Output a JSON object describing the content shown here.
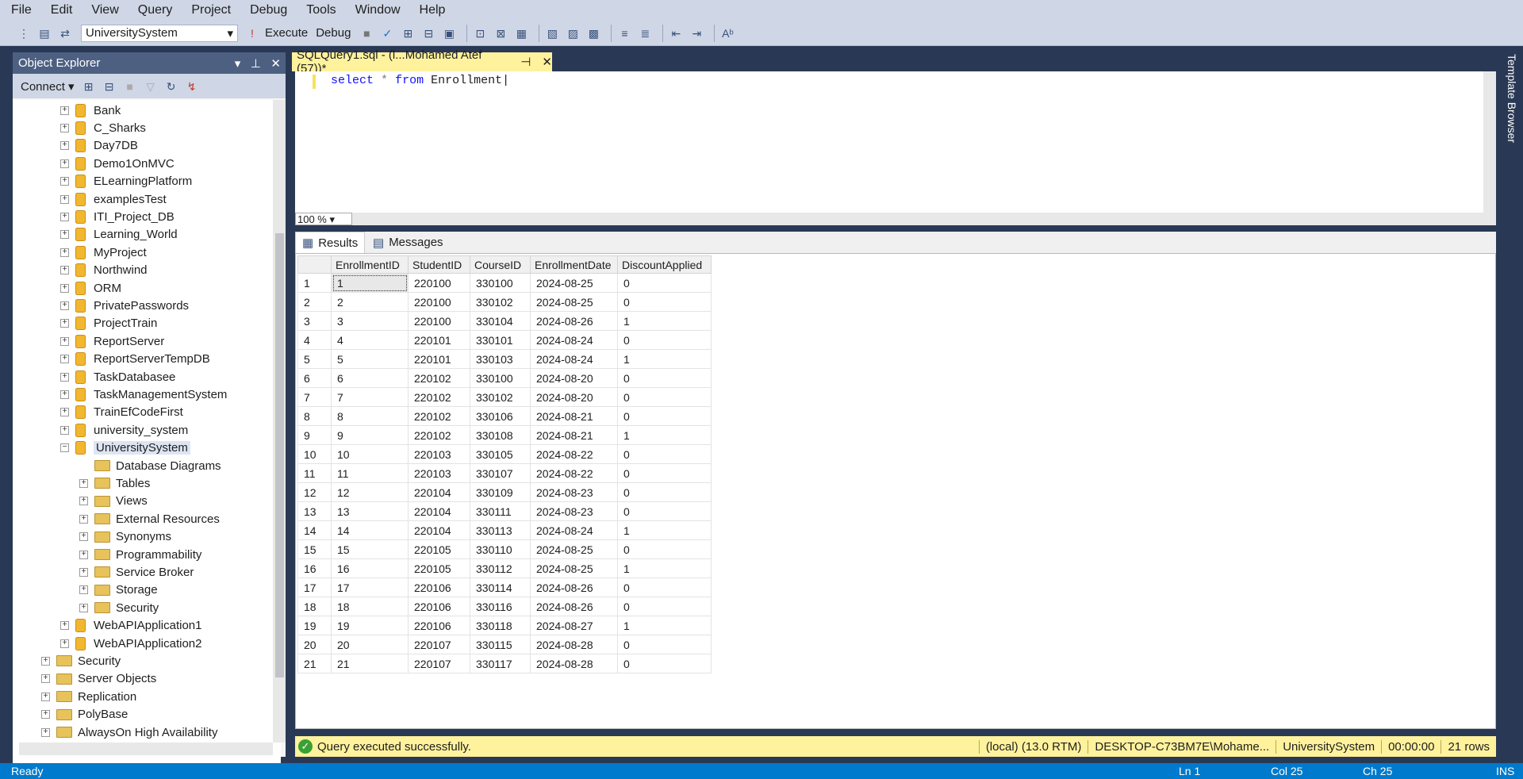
{
  "menu": [
    "File",
    "Edit",
    "View",
    "Query",
    "Project",
    "Debug",
    "Tools",
    "Window",
    "Help"
  ],
  "toolbar": {
    "database": "UniversitySystem",
    "execute": "Execute",
    "debug": "Debug"
  },
  "object_explorer": {
    "title": "Object Explorer",
    "connect": "Connect",
    "databases": [
      "Bank",
      "C_Sharks",
      "Day7DB",
      "Demo1OnMVC",
      "ELearningPlatform",
      "examplesTest",
      "ITI_Project_DB",
      "Learning_World",
      "MyProject",
      "Northwind",
      "ORM",
      "PrivatePasswords",
      "ProjectTrain",
      "ReportServer",
      "ReportServerTempDB",
      "TaskDatabasee",
      "TaskManagementSystem",
      "TrainEfCodeFirst",
      "university_system",
      "UniversitySystem"
    ],
    "university_children": [
      "Database Diagrams",
      "Tables",
      "Views",
      "External Resources",
      "Synonyms",
      "Programmability",
      "Service Broker",
      "Storage",
      "Security"
    ],
    "more_databases": [
      "WebAPIApplication1",
      "WebAPIApplication2"
    ],
    "server_nodes": [
      "Security",
      "Server Objects",
      "Replication",
      "PolyBase",
      "AlwaysOn High Availability"
    ]
  },
  "editor": {
    "tab_title": "SQLQuery1.sql - (l...Mohamed Atef (57))*",
    "code_kw1": "select",
    "code_op": "*",
    "code_kw2": "from",
    "code_table": "Enrollment",
    "zoom": "100 %"
  },
  "results": {
    "tab_results": "Results",
    "tab_messages": "Messages",
    "columns": [
      "EnrollmentID",
      "StudentID",
      "CourseID",
      "EnrollmentDate",
      "DiscountApplied"
    ],
    "rows": [
      [
        "1",
        "1",
        "220100",
        "330100",
        "2024-08-25",
        "0"
      ],
      [
        "2",
        "2",
        "220100",
        "330102",
        "2024-08-25",
        "0"
      ],
      [
        "3",
        "3",
        "220100",
        "330104",
        "2024-08-26",
        "1"
      ],
      [
        "4",
        "4",
        "220101",
        "330101",
        "2024-08-24",
        "0"
      ],
      [
        "5",
        "5",
        "220101",
        "330103",
        "2024-08-24",
        "1"
      ],
      [
        "6",
        "6",
        "220102",
        "330100",
        "2024-08-20",
        "0"
      ],
      [
        "7",
        "7",
        "220102",
        "330102",
        "2024-08-20",
        "0"
      ],
      [
        "8",
        "8",
        "220102",
        "330106",
        "2024-08-21",
        "0"
      ],
      [
        "9",
        "9",
        "220102",
        "330108",
        "2024-08-21",
        "1"
      ],
      [
        "10",
        "10",
        "220103",
        "330105",
        "2024-08-22",
        "0"
      ],
      [
        "11",
        "11",
        "220103",
        "330107",
        "2024-08-22",
        "0"
      ],
      [
        "12",
        "12",
        "220104",
        "330109",
        "2024-08-23",
        "0"
      ],
      [
        "13",
        "13",
        "220104",
        "330111",
        "2024-08-23",
        "0"
      ],
      [
        "14",
        "14",
        "220104",
        "330113",
        "2024-08-24",
        "1"
      ],
      [
        "15",
        "15",
        "220105",
        "330110",
        "2024-08-25",
        "0"
      ],
      [
        "16",
        "16",
        "220105",
        "330112",
        "2024-08-25",
        "1"
      ],
      [
        "17",
        "17",
        "220106",
        "330114",
        "2024-08-26",
        "0"
      ],
      [
        "18",
        "18",
        "220106",
        "330116",
        "2024-08-26",
        "0"
      ],
      [
        "19",
        "19",
        "220106",
        "330118",
        "2024-08-27",
        "1"
      ],
      [
        "20",
        "20",
        "220107",
        "330115",
        "2024-08-28",
        "0"
      ],
      [
        "21",
        "21",
        "220107",
        "330117",
        "2024-08-28",
        "0"
      ]
    ]
  },
  "query_status": {
    "message": "Query executed successfully.",
    "server": "(local) (13.0 RTM)",
    "user": "DESKTOP-C73BM7E\\Mohame...",
    "database": "UniversitySystem",
    "time": "00:00:00",
    "rows": "21 rows"
  },
  "statusbar": {
    "ready": "Ready",
    "ln": "Ln 1",
    "col": "Col 25",
    "ch": "Ch 25",
    "ins": "INS"
  },
  "side_panel": "Template Browser"
}
